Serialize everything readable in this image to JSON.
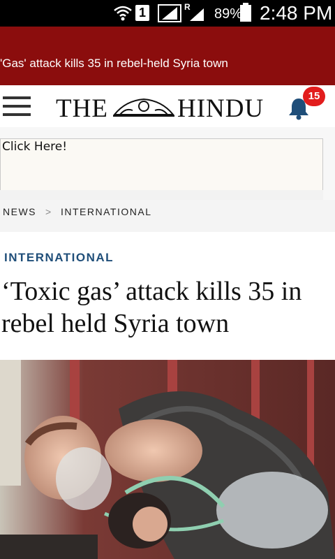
{
  "status_bar": {
    "sim_slot": "1",
    "roaming_indicator": "R",
    "battery_percent": "89%",
    "time": "2:48 PM",
    "icons": [
      "wifi-icon",
      "sim-icon",
      "signal-icon",
      "roaming-signal-icon",
      "battery-icon"
    ]
  },
  "banner": {
    "headline": "'Gas' attack kills 35 in rebel-held Syria town",
    "background": "#8b0d0d"
  },
  "header": {
    "logo_left": "THE",
    "logo_right": "HINDU",
    "notification_count": "15",
    "badge_color": "#e21d1d",
    "bell_color": "#1f4e79"
  },
  "ad": {
    "text": "Click Here!"
  },
  "breadcrumb": {
    "items": [
      "NEWS",
      "INTERNATIONAL"
    ],
    "separator": ">"
  },
  "article": {
    "section": "INTERNATIONAL",
    "title": "‘Toxic gas’ attack kills 35 in rebel held Syria town",
    "section_color": "#1f4e79"
  }
}
